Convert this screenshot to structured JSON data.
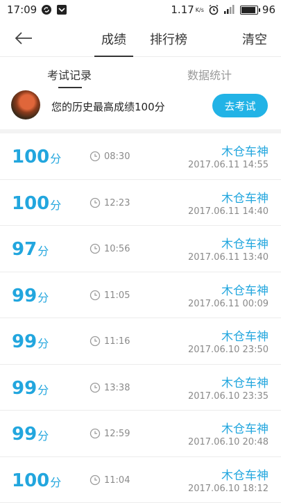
{
  "status_bar": {
    "time": "17:09",
    "network_speed": "1.17",
    "network_unit": "K/s",
    "battery": "96"
  },
  "nav": {
    "tabs": [
      "成绩",
      "排行榜"
    ],
    "clear_label": "清空"
  },
  "sub_tabs": {
    "records_label": "考试记录",
    "stats_label": "数据统计"
  },
  "best": {
    "text": "您的历史最高成绩100分",
    "button_label": "去考试"
  },
  "records": [
    {
      "score": "100",
      "unit": "分",
      "duration": "08:30",
      "user": "木仓车神",
      "datetime": "2017.06.11  14:55"
    },
    {
      "score": "100",
      "unit": "分",
      "duration": "12:23",
      "user": "木仓车神",
      "datetime": "2017.06.11  14:40"
    },
    {
      "score": "97",
      "unit": "分",
      "duration": "10:56",
      "user": "木仓车神",
      "datetime": "2017.06.11  13:40"
    },
    {
      "score": "99",
      "unit": "分",
      "duration": "11:05",
      "user": "木仓车神",
      "datetime": "2017.06.11  00:09"
    },
    {
      "score": "99",
      "unit": "分",
      "duration": "11:16",
      "user": "木仓车神",
      "datetime": "2017.06.10  23:50"
    },
    {
      "score": "99",
      "unit": "分",
      "duration": "13:38",
      "user": "木仓车神",
      "datetime": "2017.06.10  23:35"
    },
    {
      "score": "99",
      "unit": "分",
      "duration": "12:59",
      "user": "木仓车神",
      "datetime": "2017.06.10  20:48"
    },
    {
      "score": "100",
      "unit": "分",
      "duration": "11:04",
      "user": "木仓车神",
      "datetime": "2017.06.10  18:12"
    }
  ],
  "colors": {
    "accent": "#22a6de",
    "button": "#22b3e6"
  }
}
